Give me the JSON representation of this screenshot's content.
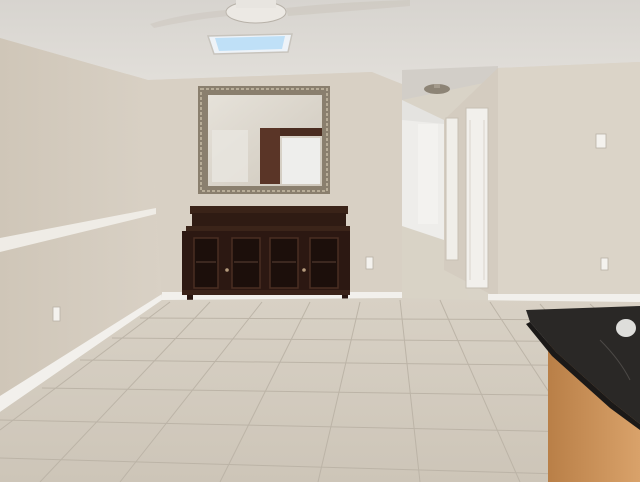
{
  "scene": {
    "kind": "real-estate interior photo",
    "room": "dining area",
    "objects": [
      "ceiling-fan",
      "skylight",
      "ornate-wall-mirror",
      "dark-wood-buffet-cabinet",
      "chair-rail-molding",
      "white-baseboard",
      "hallway",
      "interior-doors",
      "hallway-ceiling-light",
      "kitchen-counter-dark-top",
      "wall-outlets",
      "light-switch"
    ],
    "colors": {
      "wall": "#d8d0c4",
      "wall_shadow": "#c9c0b3",
      "ceiling": "#dedbd6",
      "floor_tile": "#d3ccc0",
      "grout": "#b9b1a5",
      "cabinet": "#2e1a12",
      "mirror_frame": "#8a7f6e",
      "counter_top": "#2a2826",
      "counter_base": "#c9905a",
      "baseboard": "#f2f0ec"
    }
  }
}
